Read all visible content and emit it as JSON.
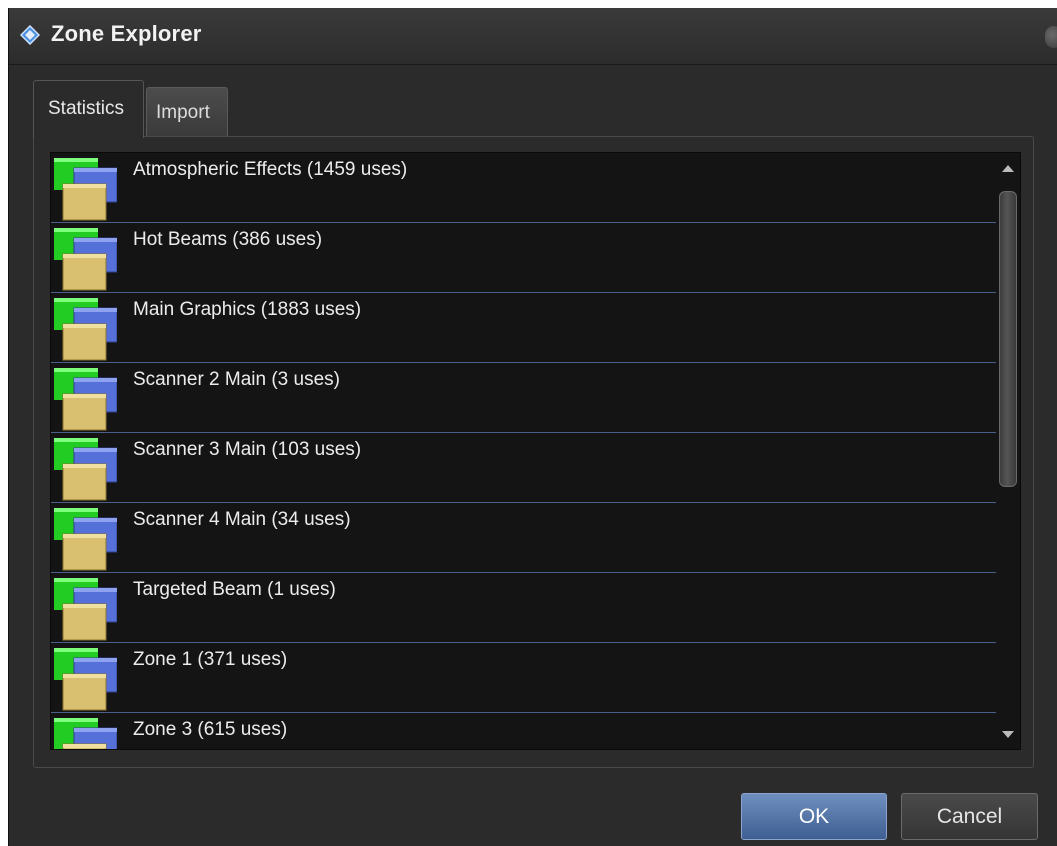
{
  "window": {
    "title": "Zone Explorer",
    "title_icon": "diamond-icon"
  },
  "tabs": [
    {
      "label": "Statistics",
      "active": true
    },
    {
      "label": "Import",
      "active": false
    }
  ],
  "list": {
    "item_icon": "layers-icon",
    "items": [
      {
        "label": "Atmospheric Effects (1459 uses)"
      },
      {
        "label": "Hot Beams (386 uses)"
      },
      {
        "label": "Main Graphics (1883 uses)"
      },
      {
        "label": "Scanner 2 Main (3 uses)"
      },
      {
        "label": "Scanner 3 Main (103 uses)"
      },
      {
        "label": "Scanner 4 Main (34 uses)"
      },
      {
        "label": "Targeted Beam (1 uses)"
      },
      {
        "label": "Zone 1 (371 uses)"
      },
      {
        "label": "Zone 3 (615 uses)"
      }
    ]
  },
  "buttons": {
    "ok_label": "OK",
    "cancel_label": "Cancel"
  },
  "colors": {
    "window_bg": "#2b2b2b",
    "list_bg": "#141414",
    "separator": "#4a5f8a",
    "ok_button": "#5677aa",
    "icon_green": "#22cc22",
    "icon_blue": "#5570d8",
    "icon_yellow": "#d8c070"
  }
}
